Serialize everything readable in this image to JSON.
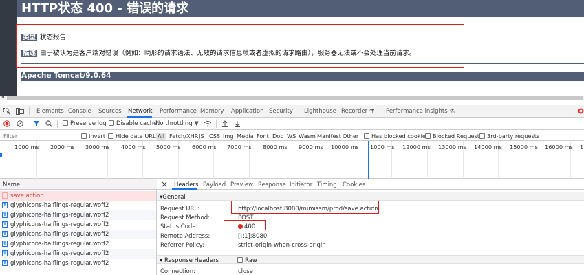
{
  "error_page": {
    "title": "HTTP状态 400 - 错误的请求",
    "type_label": "类型",
    "type_value": "状态报告",
    "desc_label": "描述",
    "desc_value": "由于被认为是客户端对错误（例如：畸形的请求语法、无效的请求信息帧或者虚拟的请求路由），服务器无法或不会处理当前请求。",
    "footer": "Apache Tomcat/9.0.64"
  },
  "devtools": {
    "tabs": [
      "Elements",
      "Console",
      "Sources",
      "Network",
      "Performance",
      "Memory",
      "Application",
      "Security",
      "Lighthouse",
      "Recorder",
      "Performance insights"
    ],
    "active_tab": "Network",
    "toolbar": {
      "preserve_log": "Preserve log",
      "disable_cache": "Disable cache",
      "throttling": "No throttling"
    },
    "filter": {
      "placeholder": "Filter",
      "invert": "Invert",
      "hide_data_urls": "Hide data URLs",
      "types": [
        "All",
        "Fetch/XHR",
        "JS",
        "CSS",
        "Img",
        "Media",
        "Font",
        "Doc",
        "WS",
        "Wasm",
        "Manifest",
        "Other"
      ],
      "selected_type": "All",
      "has_blocked_cookies": "Has blocked cookies",
      "blocked_requests": "Blocked Requests",
      "third_party": "3rd-party requests"
    },
    "timeline_labels": [
      "1000 ms",
      "2000 ms",
      "3000 ms",
      "4000 ms",
      "5000 ms",
      "6000 ms",
      "7000 ms",
      "8000 ms",
      "9000 ms",
      "10000 ms",
      "1000 ms",
      "12000 ms",
      "13000 ms",
      "14000 ms",
      "15000 ms",
      "16000 ms",
      "1"
    ],
    "request_list": {
      "header": "Name",
      "items": [
        {
          "name": "save.action",
          "status": "error"
        },
        {
          "name": "glyphicons-halflings-regular.woff2",
          "status": "ok"
        },
        {
          "name": "glyphicons-halflings-regular.woff2",
          "status": "ok"
        },
        {
          "name": "glyphicons-halflings-regular.woff2",
          "status": "ok"
        },
        {
          "name": "glyphicons-halflings-regular.woff2",
          "status": "ok"
        },
        {
          "name": "glyphicons-halflings-regular.woff2",
          "status": "ok"
        },
        {
          "name": "glyphicons-halflings-regular.woff2",
          "status": "ok"
        },
        {
          "name": "glyphicons-halflings-regular.woff2",
          "status": "ok"
        }
      ]
    },
    "details": {
      "tabs": [
        "Headers",
        "Payload",
        "Preview",
        "Response",
        "Initiator",
        "Timing",
        "Cookies"
      ],
      "active_tab": "Headers",
      "general_title": "General",
      "general": [
        {
          "key": "Request URL:",
          "value": "http://localhost:8080/mimissm/prod/save.action"
        },
        {
          "key": "Request Method:",
          "value": "POST"
        },
        {
          "key": "Status Code:",
          "value": "400"
        },
        {
          "key": "Remote Address:",
          "value": "[::1]:8080"
        },
        {
          "key": "Referrer Policy:",
          "value": "strict-origin-when-cross-origin"
        }
      ],
      "response_headers_title": "Response Headers",
      "raw_label": "Raw",
      "response_headers": [
        {
          "key": "Connection:",
          "value": "close"
        }
      ]
    }
  },
  "colors": {
    "tomcat_bar": "#525d76",
    "annotation_red": "#d32020",
    "devtools_blue": "#1a73e8",
    "error_row_bg": "#fde3e3",
    "error_text": "#e04040"
  }
}
